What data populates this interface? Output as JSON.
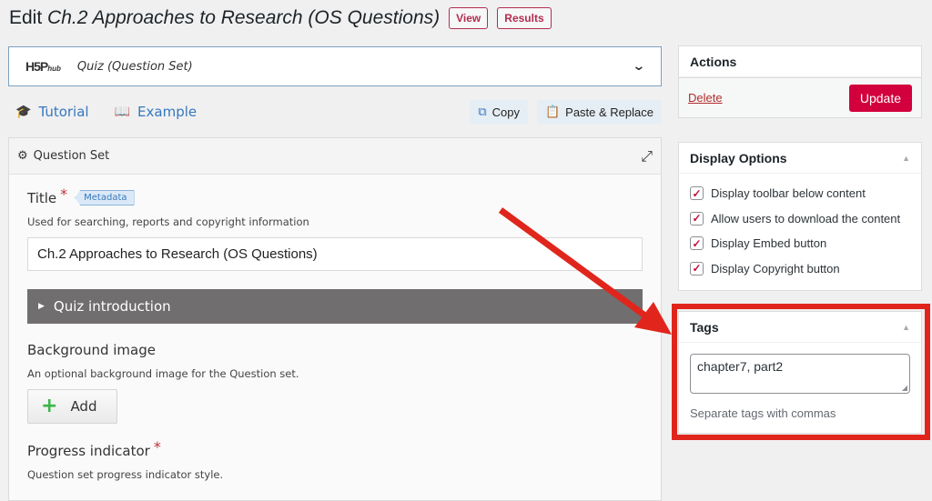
{
  "header": {
    "prefix": "Edit",
    "title": "Ch.2 Approaches to Research (OS Questions)",
    "view_label": "View",
    "results_label": "Results"
  },
  "hub": {
    "logo_text": "H5P",
    "logo_sub": "hub",
    "content_type": "Quiz (Question Set)",
    "chevron_icon": "chevron-down-icon"
  },
  "toolbar": {
    "tutorial_label": "Tutorial",
    "example_label": "Example",
    "copy_label": "Copy",
    "paste_label": "Paste & Replace"
  },
  "question_set": {
    "header_label": "Question Set",
    "title_label": "Title",
    "required_mark": "*",
    "metadata_label": "Metadata",
    "title_desc": "Used for searching, reports and copyright information",
    "title_value": "Ch.2 Approaches to Research (OS Questions)",
    "quiz_intro_label": "Quiz introduction",
    "bg_image_label": "Background image",
    "bg_image_desc": "An optional background image for the Question set.",
    "add_label": "Add",
    "progress_label": "Progress indicator",
    "progress_desc": "Question set progress indicator style."
  },
  "actions": {
    "title": "Actions",
    "delete_label": "Delete",
    "update_label": "Update"
  },
  "display_options": {
    "title": "Display Options",
    "options": [
      {
        "label": "Display toolbar below content",
        "checked": true
      },
      {
        "label": "Allow users to download the content",
        "checked": true
      },
      {
        "label": "Display Embed button",
        "checked": true
      },
      {
        "label": "Display Copyright button",
        "checked": true
      }
    ]
  },
  "tags": {
    "title": "Tags",
    "value": "chapter7, part2",
    "help": "Separate tags with commas"
  },
  "annotation": {
    "color": "#e0261c"
  },
  "colors": {
    "accent_red": "#d2003c",
    "link_blue": "#3778bd",
    "intro_bar": "#716e6f"
  }
}
